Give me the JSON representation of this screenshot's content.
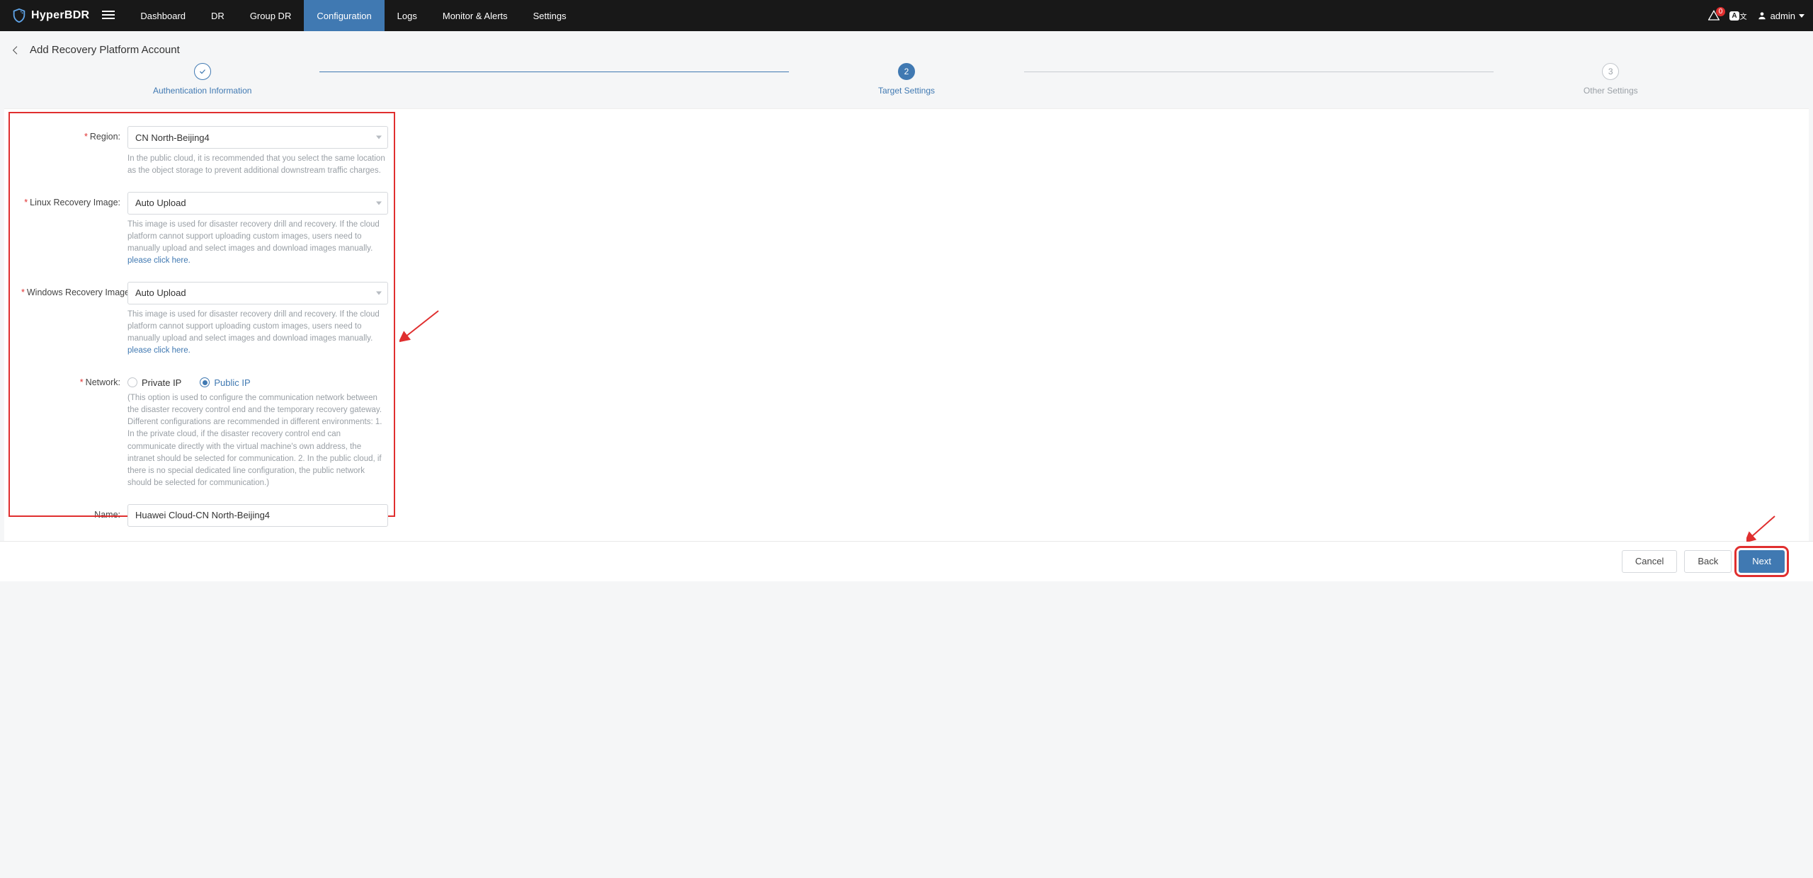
{
  "brand": "HyperBDR",
  "nav": {
    "items": [
      {
        "label": "Dashboard"
      },
      {
        "label": "DR"
      },
      {
        "label": "Group DR"
      },
      {
        "label": "Configuration",
        "active": true
      },
      {
        "label": "Logs"
      },
      {
        "label": "Monitor & Alerts"
      },
      {
        "label": "Settings"
      }
    ]
  },
  "topbar": {
    "alert_count": "0",
    "lang_badge": "A",
    "lang_sub": "文",
    "username": "admin"
  },
  "page": {
    "title": "Add Recovery Platform Account"
  },
  "steps": {
    "s1": {
      "label": "Authentication Information"
    },
    "s2": {
      "num": "2",
      "label": "Target Settings"
    },
    "s3": {
      "num": "3",
      "label": "Other Settings"
    }
  },
  "form": {
    "region": {
      "label": "Region:",
      "value": "CN North-Beijing4",
      "hint": "In the public cloud, it is recommended that you select the same location as the object storage to prevent additional downstream traffic charges."
    },
    "linux_image": {
      "label": "Linux Recovery Image:",
      "value": "Auto Upload",
      "hint": "This image is used for disaster recovery drill and recovery. If the cloud platform cannot support uploading custom images, users need to manually upload and select images and download images manually. ",
      "link": "please click here."
    },
    "windows_image": {
      "label": "Windows Recovery Image:",
      "value": "Auto Upload",
      "hint": "This image is used for disaster recovery drill and recovery. If the cloud platform cannot support uploading custom images, users need to manually upload and select images and download images manually. ",
      "link": "please click here."
    },
    "network": {
      "label": "Network:",
      "opt_private": "Private IP",
      "opt_public": "Public IP",
      "hint": "(This option is used to configure the communication network between the disaster recovery control end and the temporary recovery gateway. Different configurations are recommended in different environments: 1. In the private cloud, if the disaster recovery control end can communicate directly with the virtual machine's own address, the intranet should be selected for communication. 2. In the public cloud, if there is no special dedicated line configuration, the public network should be selected for communication.)"
    },
    "name": {
      "label": "Name:",
      "value": "Huawei Cloud-CN North-Beijing4"
    }
  },
  "footer": {
    "cancel": "Cancel",
    "back": "Back",
    "next": "Next"
  }
}
